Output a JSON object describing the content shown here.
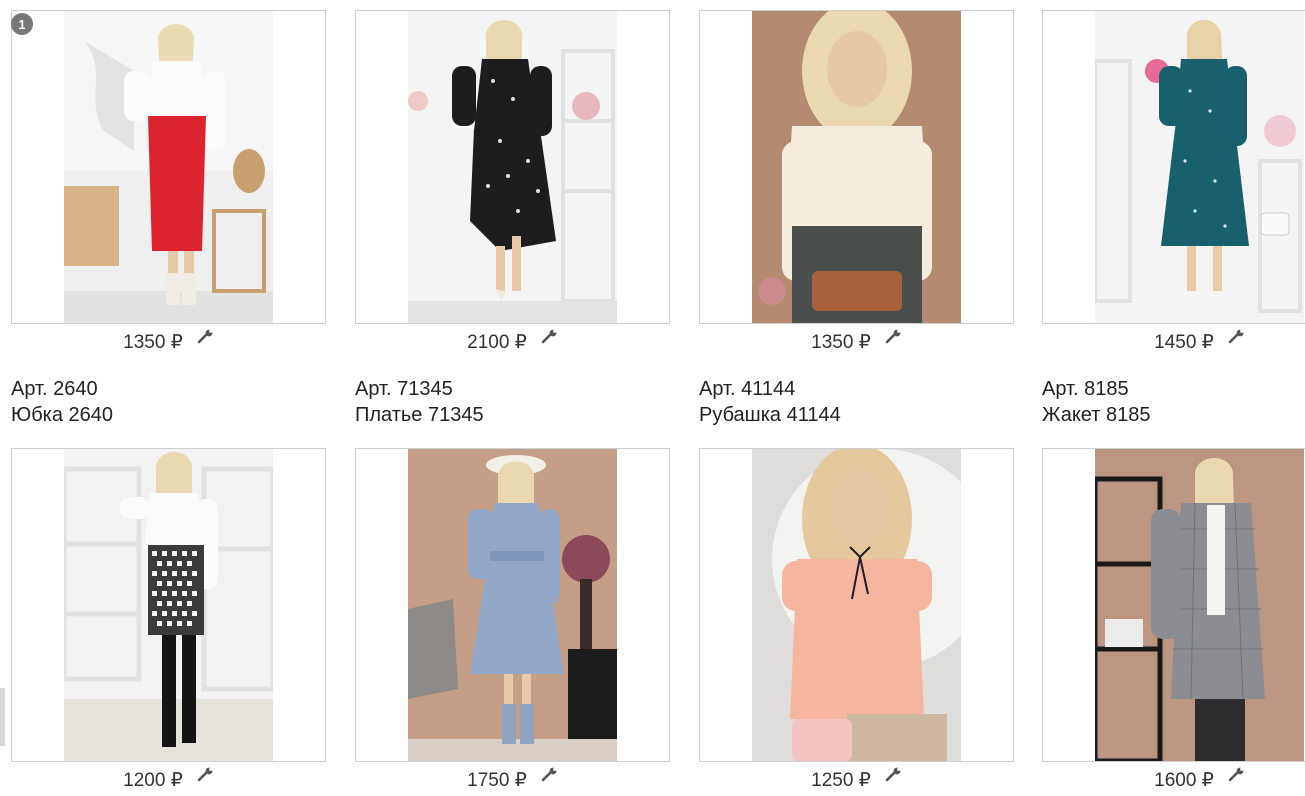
{
  "page": {
    "badge": "1"
  },
  "products": [
    {
      "price": "1350 ₽",
      "article": "Арт. 2640",
      "title": "Юбка 2640",
      "photo": "woman-white-blouse-red-skirt"
    },
    {
      "price": "2100 ₽",
      "article": "Арт. 71345",
      "title": "Платье 71345",
      "photo": "woman-black-print-dress"
    },
    {
      "price": "1350 ₽",
      "article": "Арт. 41144",
      "title": "Рубашка 41144",
      "photo": "woman-cream-blouse"
    },
    {
      "price": "1450 ₽",
      "article": "Арт. 8185",
      "title": "Жакет 8185",
      "photo": "woman-teal-polka-dress"
    },
    {
      "price": "1200 ₽",
      "photo": "woman-houndstooth-skirt"
    },
    {
      "price": "1750 ₽",
      "photo": "woman-blue-dress"
    },
    {
      "price": "1250 ₽",
      "photo": "woman-peach-blouse"
    },
    {
      "price": "1600 ₽",
      "photo": "woman-grey-check-jacket"
    }
  ],
  "icons": {
    "edit": "wrench-icon"
  }
}
